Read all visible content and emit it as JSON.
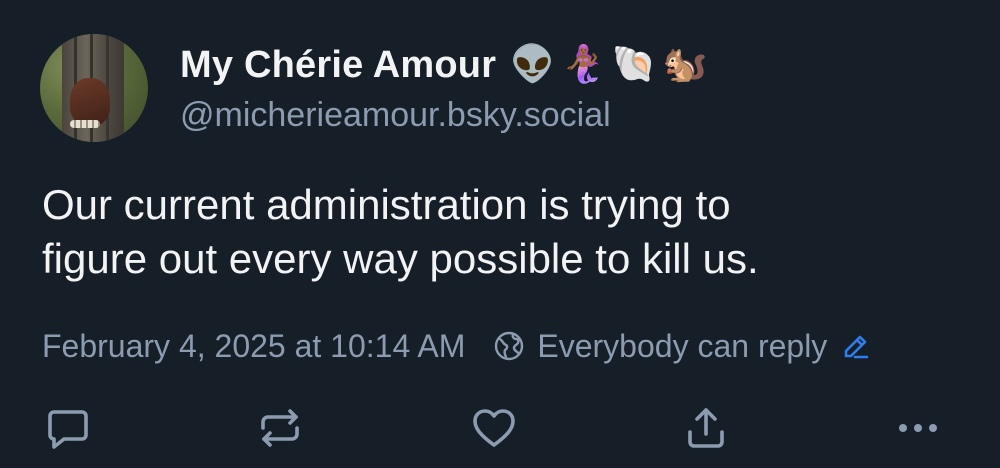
{
  "post": {
    "author": {
      "display_name": "My Chérie Amour",
      "emojis": [
        "👽",
        "🧜🏾‍♀️",
        "🐚",
        "🐿️"
      ],
      "handle": "@micherieamour.bsky.social"
    },
    "text": "Our current administration is trying to\nfigure out every way possible to kill us.",
    "timestamp": "February 4, 2025 at 10:14 AM",
    "reply_setting": "Everybody can reply"
  },
  "actions": {
    "icons": [
      "reply-icon",
      "repost-icon",
      "like-icon",
      "share-icon",
      "more-icon"
    ]
  },
  "colors": {
    "background": "#161e27",
    "primary_text": "#f1f3f5",
    "secondary_text": "#8c9bb0",
    "accent": "#2f7ef0"
  }
}
